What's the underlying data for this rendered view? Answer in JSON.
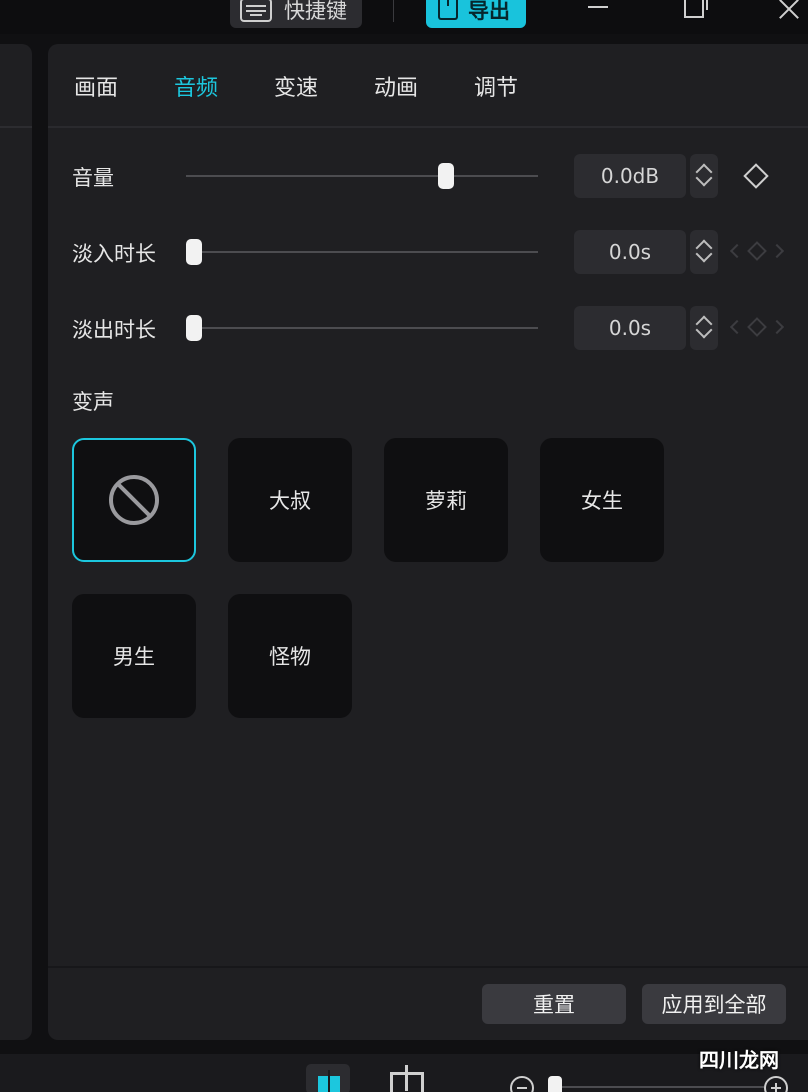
{
  "topbar": {
    "shortcut_label": "快捷键",
    "export_label": "导出"
  },
  "tabs": [
    {
      "label": "画面",
      "active": false
    },
    {
      "label": "音频",
      "active": true
    },
    {
      "label": "变速",
      "active": false
    },
    {
      "label": "动画",
      "active": false
    },
    {
      "label": "调节",
      "active": false
    }
  ],
  "audio": {
    "volume": {
      "label": "音量",
      "value": "0.0dB",
      "slider_fraction": 0.75
    },
    "fade_in": {
      "label": "淡入时长",
      "value": "0.0s",
      "slider_fraction": 0.0
    },
    "fade_out": {
      "label": "淡出时长",
      "value": "0.0s",
      "slider_fraction": 0.0
    }
  },
  "voice_change": {
    "title": "变声",
    "options": [
      {
        "label": "",
        "icon": "none-icon",
        "selected": true
      },
      {
        "label": "大叔",
        "selected": false
      },
      {
        "label": "萝莉",
        "selected": false
      },
      {
        "label": "女生",
        "selected": false
      },
      {
        "label": "男生",
        "selected": false
      },
      {
        "label": "怪物",
        "selected": false
      }
    ]
  },
  "footer": {
    "reset_label": "重置",
    "apply_all_label": "应用到全部"
  },
  "watermark": "四川龙网",
  "colors": {
    "accent": "#1cc7de",
    "panel_bg": "#1f1f22",
    "tile_bg": "#0f0f11"
  }
}
